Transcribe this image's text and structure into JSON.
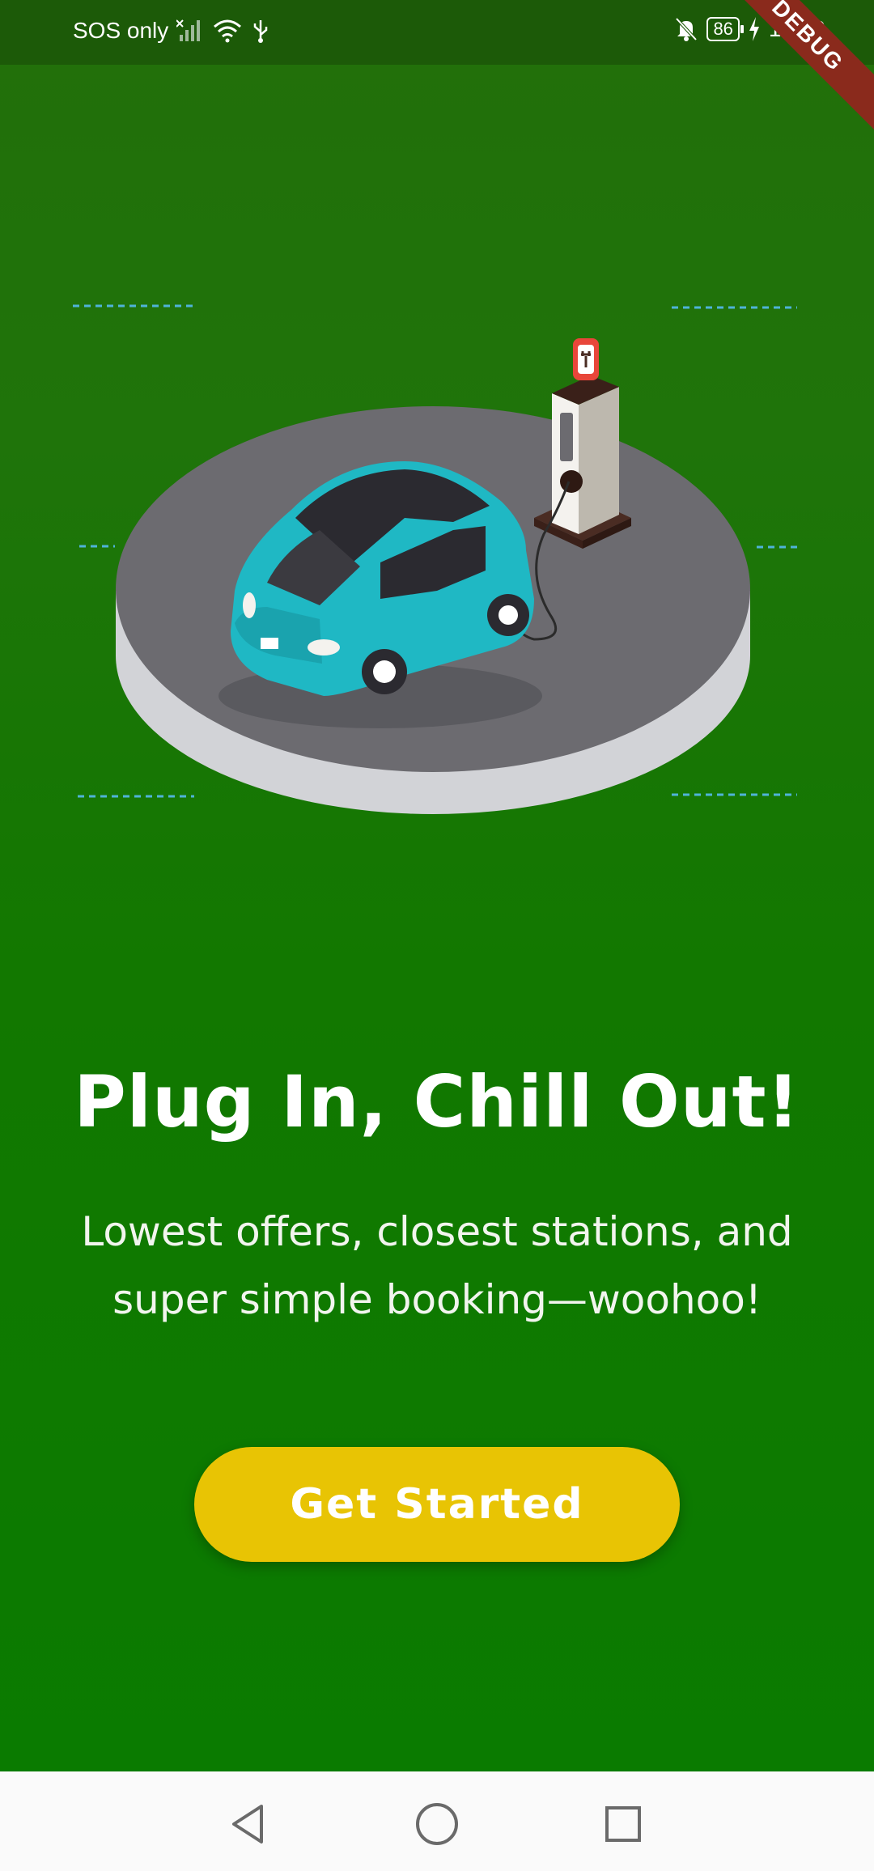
{
  "status_bar": {
    "carrier": "SOS only",
    "battery": "86",
    "time": "10:40",
    "icons": [
      "no-signal-icon",
      "wifi-icon",
      "usb-icon",
      "mute-bell-icon",
      "battery-icon",
      "charging-icon"
    ]
  },
  "debug_banner": "DEBUG",
  "illustration": {
    "subject": "ev-charging-illustration",
    "colors": {
      "car": "#1fb8c4",
      "platform_top": "#6c6b70",
      "platform_side": "#d2d3d7",
      "charger": "#f4f2ee",
      "dash_lines": "#4fb3d9"
    }
  },
  "onboarding": {
    "headline": "Plug In, Chill Out!",
    "subtitle_line1": "Lowest offers, closest stations, and",
    "subtitle_line2": "super simple booking—woohoo!",
    "cta_label": "Get Started"
  },
  "colors": {
    "background": "#127800",
    "cta": "#e8c404",
    "text": "#ffffff"
  },
  "nav_bar": {
    "buttons": [
      "back-icon",
      "home-icon",
      "recents-icon"
    ]
  }
}
